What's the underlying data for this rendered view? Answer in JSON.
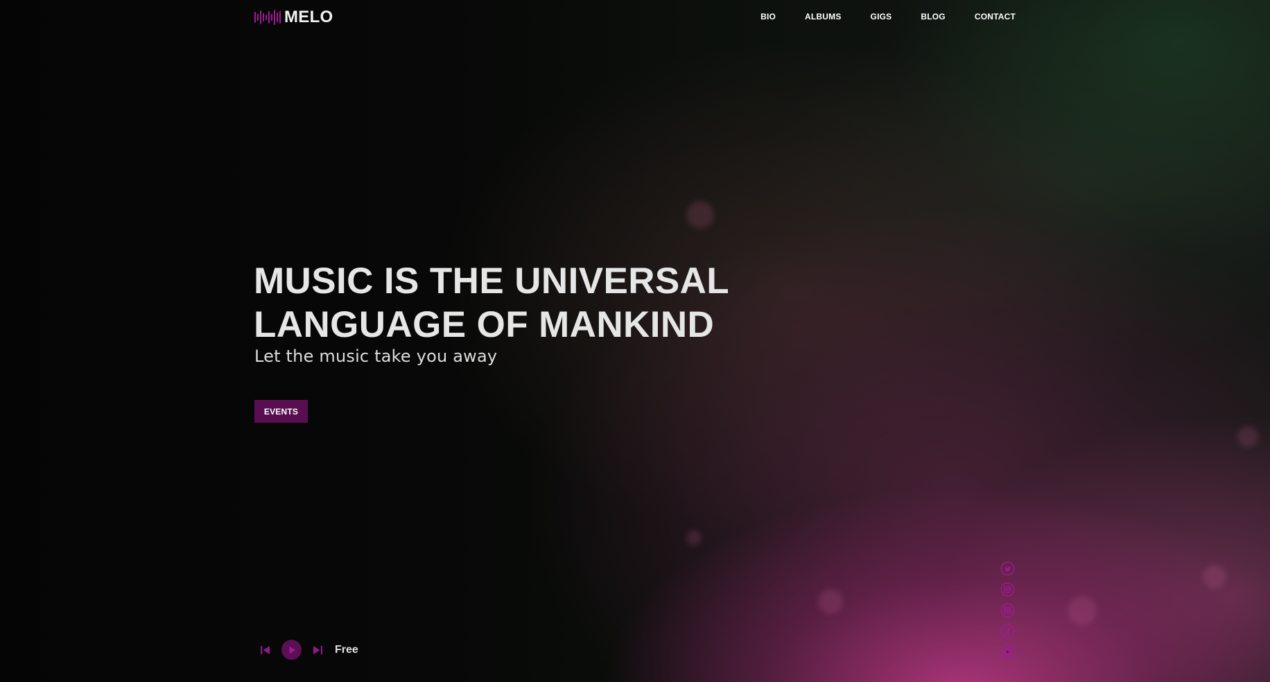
{
  "brand": {
    "name": "MELO",
    "logo_icon": "soundwave-icon",
    "accent_color": "#a3189a",
    "button_color": "#5a0e52"
  },
  "nav": {
    "items": [
      "BIO",
      "ALBUMS",
      "GIGS",
      "BLOG",
      "CONTACT"
    ]
  },
  "hero": {
    "title_line1": "MUSIC IS THE UNIVERSAL",
    "title_line2": "LANGUAGE OF MANKIND",
    "subtitle": "Let the music take you away",
    "cta_label": "EVENTS"
  },
  "player": {
    "track_title": "Free",
    "controls": [
      "skip-previous-icon",
      "play-icon",
      "skip-next-icon"
    ]
  },
  "social": {
    "icons": [
      "twitter-icon",
      "instagram-icon",
      "mixcloud-icon",
      "tiktok-icon",
      "youtube-icon"
    ]
  }
}
